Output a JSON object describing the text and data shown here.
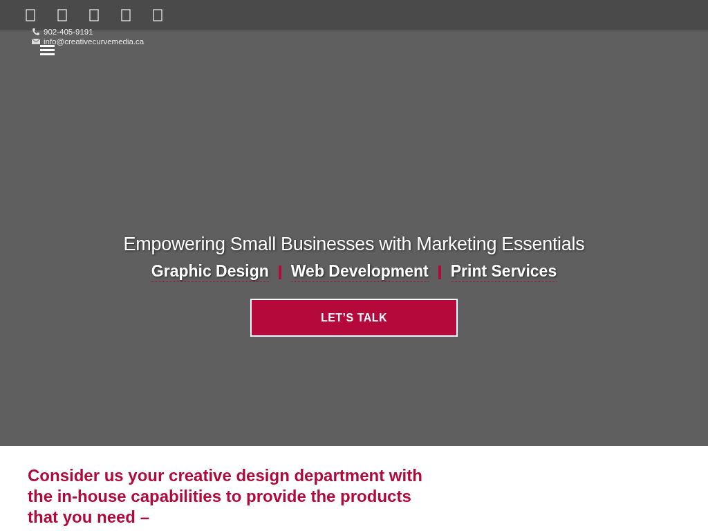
{
  "contact": {
    "phone": "902-405-9191",
    "email": "info@creativecurvemedia.ca"
  },
  "hero": {
    "title": "Empowering Small Businesses with Marketing Essentials",
    "services": [
      "Graphic Design",
      "Web Development",
      "Print Services"
    ],
    "cta": "LET’S TALK"
  },
  "intro": {
    "heading": "Consider us your creative design department with the in-house capabilities to provide the products that you need –"
  }
}
